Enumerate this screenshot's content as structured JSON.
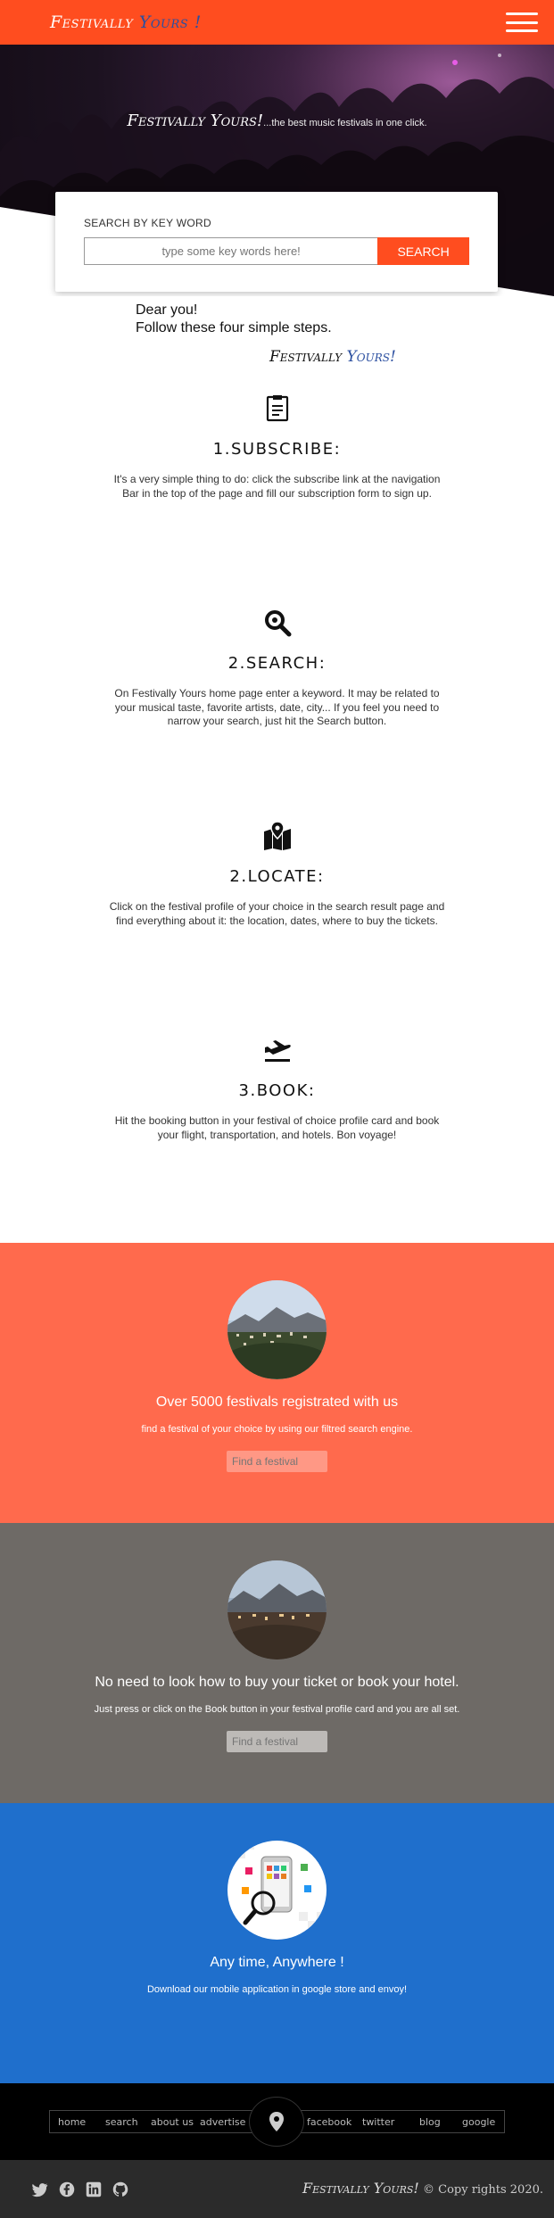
{
  "navbar": {
    "brand_a": "Festivally",
    "brand_b": "Yours !",
    "menu_icon": "hamburger-icon"
  },
  "hero": {
    "brand": "Festivally Yours!",
    "tagline": "...the best music festivals in one click.",
    "search_label": "SEARCH BY KEY WORD",
    "search_placeholder": "type some key words here!",
    "search_button": "SEARCH"
  },
  "intro": {
    "line1": "Dear you!",
    "line2": "Follow these four simple steps.",
    "signature_a": "Festivally",
    "signature_b": "Yours!"
  },
  "steps": [
    {
      "icon": "clipboard-icon",
      "title": "1.SUBSCRIBE:",
      "text": "It's a very simple thing to do: click the subscribe link at the navigation Bar in the top of the page and fill our subscription form to sign up."
    },
    {
      "icon": "search-icon",
      "title": "2.SEARCH:",
      "text": "On Festivally Yours home page enter a keyword. It may be related to your musical taste, favorite artists, date, city... If you feel you need to narrow your search, just hit the Search button."
    },
    {
      "icon": "map-icon",
      "title": "2.LOCATE:",
      "text": "Click on the festival profile of your choice in the search result page and find everything about it: the location, dates, where to buy the tickets."
    },
    {
      "icon": "airplane-icon",
      "title": "3.BOOK:",
      "text": "Hit the booking button in your festival of choice profile card and book your flight, transportation, and hotels. Bon voyage!"
    }
  ],
  "bands": [
    {
      "title": "Over 5000 festivals registrated with us",
      "sub": "find a festival of your choice by using our filtred search engine.",
      "input_placeholder": "Find a festival",
      "color": "#ff6a4d"
    },
    {
      "title": "No need to look how to buy your ticket or book your hotel.",
      "sub": "Just press or click on the Book button in your festival profile card and you are all set.",
      "input_placeholder": "Find a festival",
      "color": "#6e6a66"
    },
    {
      "title": "Any time, Anywhere !",
      "sub": "Download our mobile application in google store and envoy!",
      "color": "#1f6fcc"
    }
  ],
  "footer": {
    "nav": [
      "home",
      "search",
      "about us",
      "advertise",
      "facebook",
      "twitter",
      "blog",
      "google"
    ],
    "center_icon": "location-pin-icon",
    "social": [
      "twitter-icon",
      "facebook-icon",
      "linkedin-icon",
      "github-icon"
    ],
    "brand": "Festivally Yours!",
    "copyright": "© Copy rights 2020."
  },
  "colors": {
    "accent": "#ff4d1f",
    "brand_blue": "#2b4fa0"
  }
}
